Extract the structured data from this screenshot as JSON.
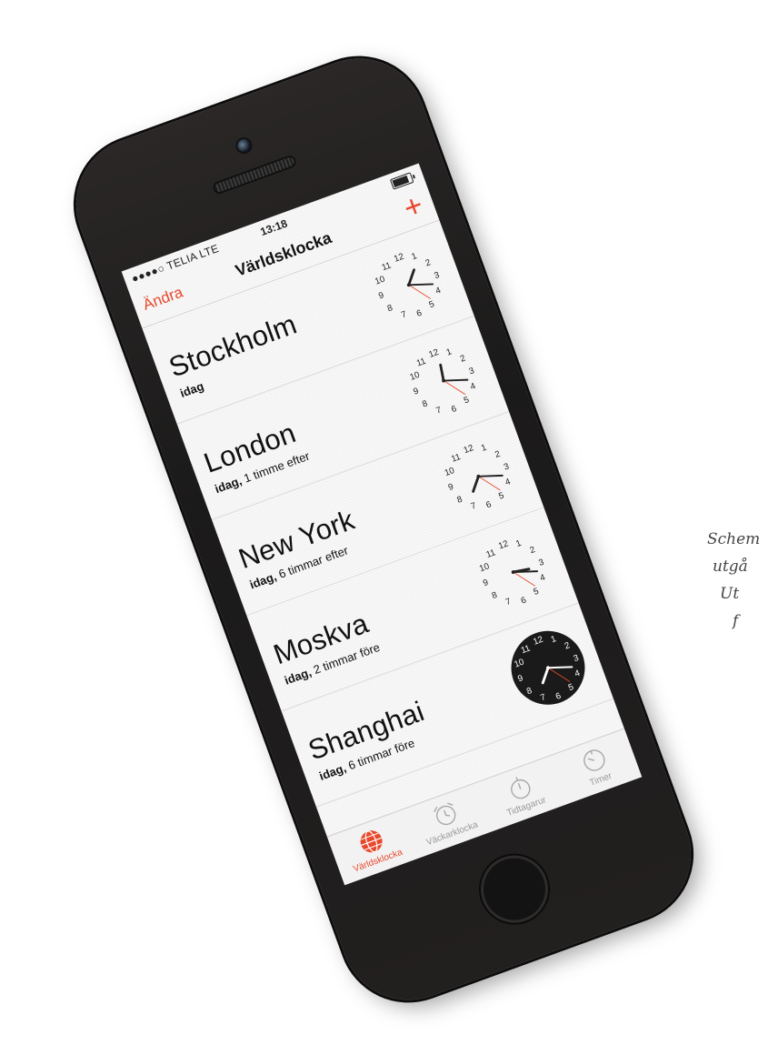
{
  "side_caption": {
    "lines": [
      "Schem",
      "utgå",
      "Ut",
      "f"
    ]
  },
  "status_bar": {
    "carrier": "●●●●○ TELIA  LTE",
    "time": "13:18"
  },
  "nav": {
    "edit_label": "Ändra",
    "title": "Världsklocka",
    "add_label": "+"
  },
  "cities": [
    {
      "name": "Stockholm",
      "day": "idag",
      "offset": "",
      "clock_time": "1:18",
      "dark": false
    },
    {
      "name": "London",
      "day": "idag,",
      "offset": "1 timme efter",
      "clock_time": "12:18",
      "dark": false
    },
    {
      "name": "New York",
      "day": "idag,",
      "offset": "6 timmar efter",
      "clock_time": "7:18",
      "dark": false
    },
    {
      "name": "Moskva",
      "day": "idag,",
      "offset": "2 timmar före",
      "clock_time": "3:18",
      "dark": false
    },
    {
      "name": "Shanghai",
      "day": "idag,",
      "offset": "6 timmar före",
      "clock_time": "7:18",
      "dark": true
    }
  ],
  "tabs": [
    {
      "label": "Världsklocka",
      "icon": "globe-icon",
      "active": true
    },
    {
      "label": "Väckarklocka",
      "icon": "alarm-clock-icon",
      "active": false
    },
    {
      "label": "Tidtagarur",
      "icon": "stopwatch-icon",
      "active": false
    },
    {
      "label": "Timer",
      "icon": "timer-icon",
      "active": false
    }
  ],
  "colors": {
    "accent": "#e8492d",
    "phone_body": "#1f1d1d",
    "screen_bg": "#f7f7f7",
    "dark_clock_face": "#1a1a1a"
  }
}
